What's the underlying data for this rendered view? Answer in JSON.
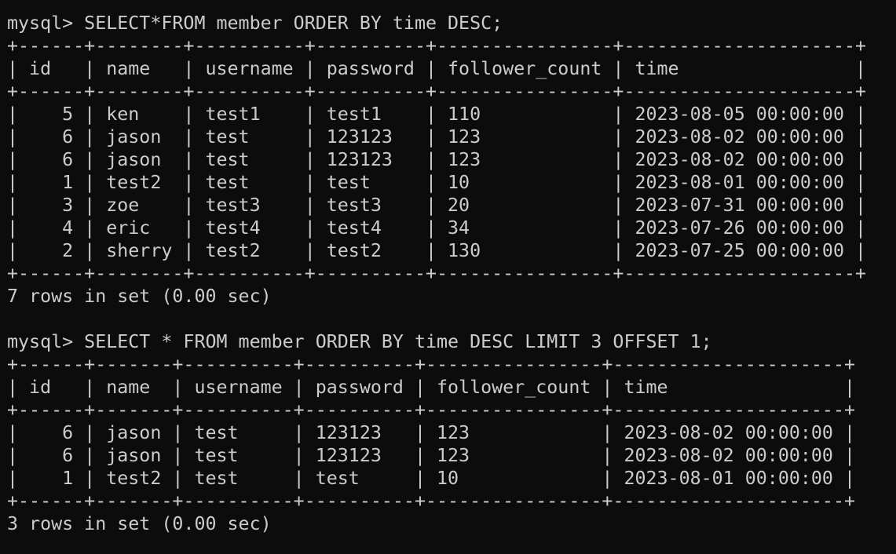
{
  "terminal": {
    "background": "#0c0c0c",
    "foreground": "#cccccc",
    "lines": [
      "mysql> SELECT*FROM member ORDER BY time DESC;",
      "+------+--------+----------+----------+----------------+---------------------+",
      "| id   | name   | username | password | follower_count | time                |",
      "+------+--------+----------+----------+----------------+---------------------+",
      "|    5 | ken    | test1    | test1    | 110            | 2023-08-05 00:00:00 |",
      "|    6 | jason  | test     | 123123   | 123            | 2023-08-02 00:00:00 |",
      "|    6 | jason  | test     | 123123   | 123            | 2023-08-02 00:00:00 |",
      "|    1 | test2  | test     | test     | 10             | 2023-08-01 00:00:00 |",
      "|    3 | zoe    | test3    | test3    | 20             | 2023-07-31 00:00:00 |",
      "|    4 | eric   | test4    | test4    | 34             | 2023-07-26 00:00:00 |",
      "|    2 | sherry | test2    | test2    | 130            | 2023-07-25 00:00:00 |",
      "+------+--------+----------+----------+----------------+---------------------+",
      "7 rows in set (0.00 sec)",
      "",
      "mysql> SELECT * FROM member ORDER BY time DESC LIMIT 3 OFFSET 1;",
      "+------+-------+----------+----------+----------------+---------------------+",
      "| id   | name  | username | password | follower_count | time                |",
      "+------+-------+----------+----------+----------------+---------------------+",
      "|    6 | jason | test     | 123123   | 123            | 2023-08-02 00:00:00 |",
      "|    6 | jason | test     | 123123   | 123            | 2023-08-02 00:00:00 |",
      "|    1 | test2 | test     | test     | 10             | 2023-08-01 00:00:00 |",
      "+------+-------+----------+----------+----------------+---------------------+",
      "3 rows in set (0.00 sec)"
    ]
  }
}
